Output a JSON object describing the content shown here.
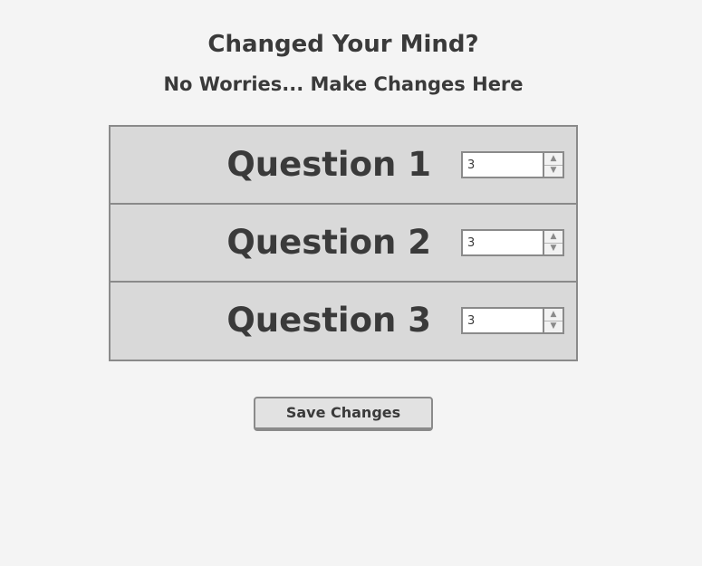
{
  "header": {
    "title": "Changed Your Mind?",
    "subtitle": "No Worries... Make Changes Here"
  },
  "questions": [
    {
      "label": "Question 1",
      "value": "3"
    },
    {
      "label": "Question 2",
      "value": "3"
    },
    {
      "label": "Question 3",
      "value": "3"
    }
  ],
  "actions": {
    "save_label": "Save Changes"
  },
  "icons": {
    "stepper_up": "triangle-up-icon",
    "stepper_down": "triangle-down-icon"
  }
}
